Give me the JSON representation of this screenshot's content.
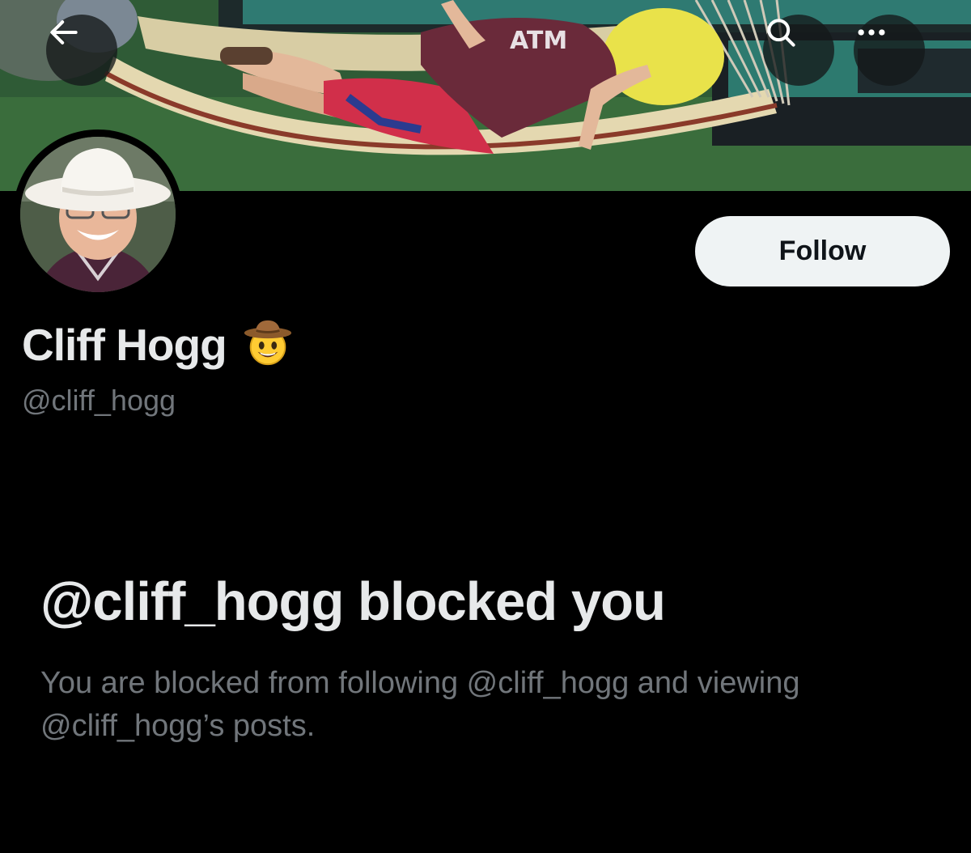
{
  "profile": {
    "display_name": "Cliff Hogg",
    "name_emoji": "🤠",
    "handle": "@cliff_hogg"
  },
  "actions": {
    "follow_label": "Follow",
    "back_icon": "arrow-left-icon",
    "search_icon": "search-icon",
    "more_icon": "more-horizontal-icon"
  },
  "blocked": {
    "title": "@cliff_hogg blocked you",
    "description": "You are blocked from following @cliff_hogg and viewing @cliff_hogg’s posts."
  },
  "colors": {
    "background": "#000000",
    "primary_text": "#e7e9ea",
    "secondary_text": "#71767b",
    "follow_button_bg": "#eff3f4",
    "follow_button_text": "#0f1419"
  }
}
